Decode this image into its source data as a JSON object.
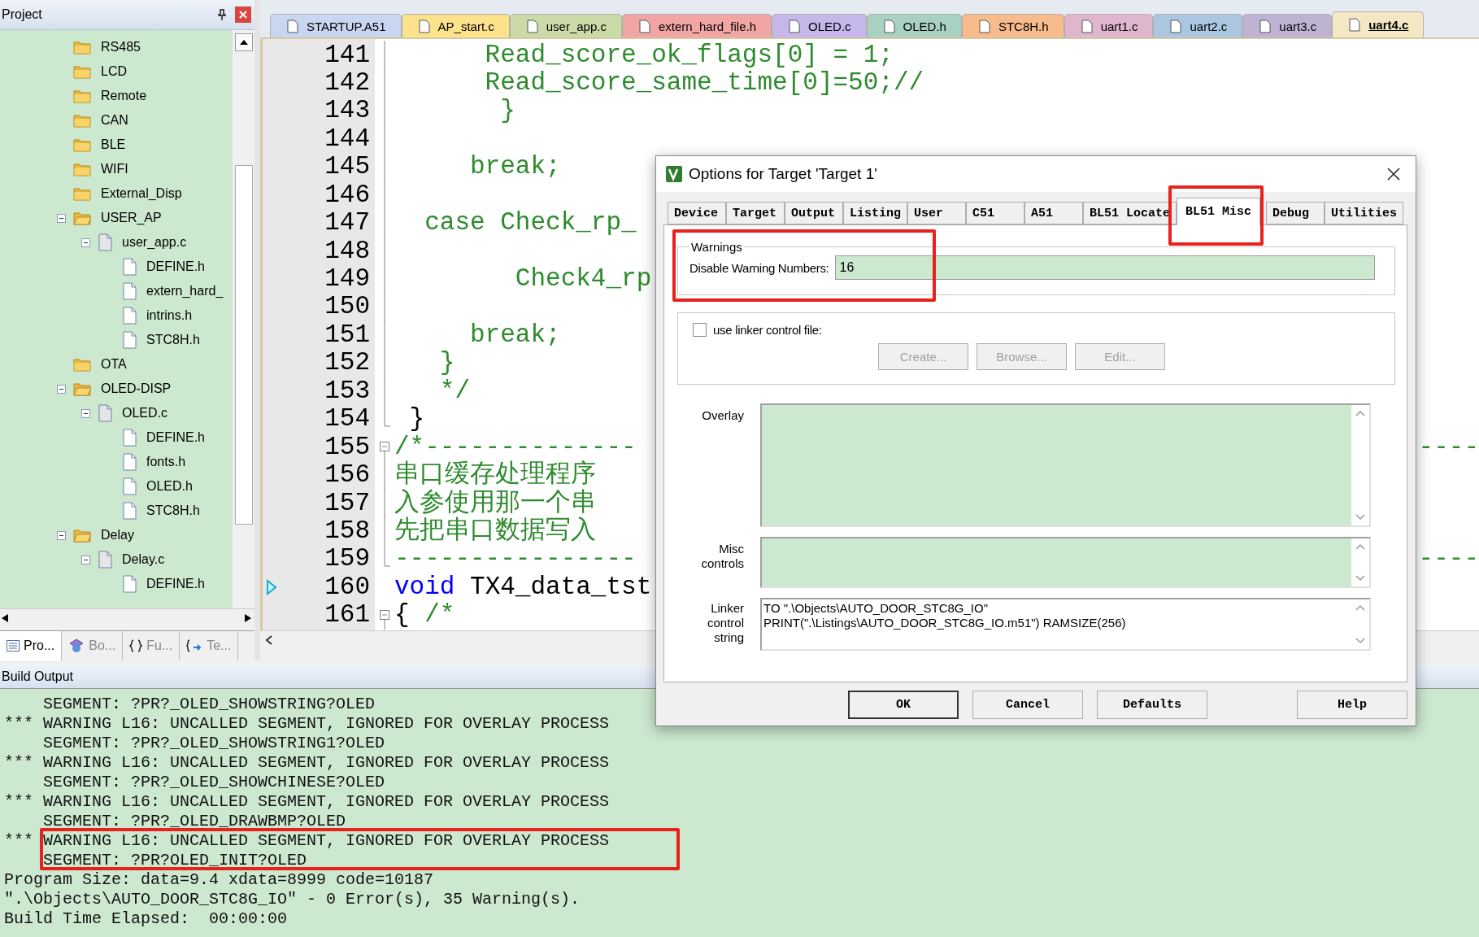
{
  "project_panel": {
    "title": "Project",
    "tree": [
      {
        "label": "RS485",
        "kind": "folder"
      },
      {
        "label": "LCD",
        "kind": "folder"
      },
      {
        "label": "Remote",
        "kind": "folder"
      },
      {
        "label": "CAN",
        "kind": "folder"
      },
      {
        "label": "BLE",
        "kind": "folder"
      },
      {
        "label": "WIFI",
        "kind": "folder"
      },
      {
        "label": "External_Disp",
        "kind": "folder"
      },
      {
        "label": "USER_AP",
        "kind": "folder",
        "expanded": true,
        "children": [
          {
            "label": "user_app.c",
            "kind": "source",
            "expanded": true,
            "children": [
              {
                "label": "DEFINE.h",
                "kind": "file"
              },
              {
                "label": "extern_hard_",
                "kind": "file"
              },
              {
                "label": "intrins.h",
                "kind": "file"
              },
              {
                "label": "STC8H.h",
                "kind": "file"
              }
            ]
          }
        ]
      },
      {
        "label": "OTA",
        "kind": "folder"
      },
      {
        "label": "OLED-DISP",
        "kind": "folder",
        "expanded": true,
        "children": [
          {
            "label": "OLED.c",
            "kind": "source",
            "expanded": true,
            "children": [
              {
                "label": "DEFINE.h",
                "kind": "file"
              },
              {
                "label": "fonts.h",
                "kind": "file"
              },
              {
                "label": "OLED.h",
                "kind": "file"
              },
              {
                "label": "STC8H.h",
                "kind": "file"
              }
            ]
          }
        ]
      },
      {
        "label": "Delay",
        "kind": "folder",
        "expanded": true,
        "children": [
          {
            "label": "Delay.c",
            "kind": "source",
            "expanded": true,
            "children": [
              {
                "label": "DEFINE.h",
                "kind": "file"
              }
            ]
          }
        ]
      }
    ],
    "tabs": [
      {
        "label": "Pro...",
        "kind": "project",
        "selected": true
      },
      {
        "label": "Bo...",
        "kind": "books",
        "selected": false
      },
      {
        "label": "Fu...",
        "kind": "functions",
        "selected": false
      },
      {
        "label": "Te...",
        "kind": "templates",
        "selected": false
      }
    ]
  },
  "editor": {
    "tabs": [
      {
        "label": "STARTUP.A51",
        "color": "#c8d6f2",
        "selected": false
      },
      {
        "label": "AP_start.c",
        "color": "#fde28c",
        "selected": false
      },
      {
        "label": "user_app.c",
        "color": "#cbdba8",
        "selected": false
      },
      {
        "label": "extern_hard_file.h",
        "color": "#f2a5a5",
        "selected": false
      },
      {
        "label": "OLED.c",
        "color": "#c6b7ea",
        "selected": false
      },
      {
        "label": "OLED.h",
        "color": "#a9d1c2",
        "selected": false
      },
      {
        "label": "STC8H.h",
        "color": "#f7bb8c",
        "selected": false
      },
      {
        "label": "uart1.c",
        "color": "#e0b6ce",
        "selected": false
      },
      {
        "label": "uart2.c",
        "color": "#abc6e0",
        "selected": false
      },
      {
        "label": "uart3.c",
        "color": "#bfb3d4",
        "selected": false
      },
      {
        "label": "uart4.c",
        "color": "#f4e8c4",
        "selected": true
      }
    ],
    "lines": [
      {
        "number": "141",
        "kind": "fold_body",
        "current": false,
        "segments": [
          {
            "text": "      Read_score_ok_flags[0] = 1;",
            "kind": "comment"
          }
        ]
      },
      {
        "number": "142",
        "kind": "fold_body",
        "current": false,
        "segments": [
          {
            "text": "      Read_score_same_time[0]=50;//",
            "kind": "comment"
          }
        ]
      },
      {
        "number": "143",
        "kind": "fold_body",
        "current": false,
        "segments": [
          {
            "text": "       }",
            "kind": "comment"
          }
        ]
      },
      {
        "number": "144",
        "kind": "fold_body",
        "current": false
      },
      {
        "number": "145",
        "kind": "fold_body",
        "current": false,
        "segments": [
          {
            "text": "     break;",
            "kind": "comment"
          }
        ]
      },
      {
        "number": "146",
        "kind": "fold_body",
        "current": false
      },
      {
        "number": "147",
        "kind": "fold_body",
        "current": false,
        "segments": [
          {
            "text": "  case Check_rp_",
            "kind": "comment"
          }
        ]
      },
      {
        "number": "148",
        "kind": "fold_body",
        "current": false
      },
      {
        "number": "149",
        "kind": "fold_body",
        "current": false,
        "segments": [
          {
            "text": "        Check4_rp",
            "kind": "comment"
          }
        ]
      },
      {
        "number": "150",
        "kind": "fold_body",
        "current": false
      },
      {
        "number": "151",
        "kind": "fold_body",
        "current": false,
        "segments": [
          {
            "text": "     break;",
            "kind": "comment"
          }
        ]
      },
      {
        "number": "152",
        "kind": "fold_body",
        "current": false,
        "segments": [
          {
            "text": "   }",
            "kind": "comment"
          }
        ]
      },
      {
        "number": "153",
        "kind": "fold_body",
        "current": false,
        "segments": [
          {
            "text": "   */",
            "kind": "comment"
          }
        ]
      },
      {
        "number": "154",
        "kind": "fold_end",
        "current": false,
        "segments": [
          {
            "text": " }",
            "kind": "plain"
          }
        ]
      },
      {
        "number": "155",
        "kind": "fold_start",
        "current": false,
        "segments": [
          {
            "text": "/*--------------",
            "kind": "comment"
          }
        ],
        "tail": "----"
      },
      {
        "number": "156",
        "kind": "fold_body",
        "current": false,
        "segments": [
          {
            "text": "串口缓存处理程序",
            "kind": "comment"
          }
        ]
      },
      {
        "number": "157",
        "kind": "fold_body",
        "current": false,
        "segments": [
          {
            "text": "入参使用那一个串",
            "kind": "comment"
          }
        ]
      },
      {
        "number": "158",
        "kind": "fold_body",
        "current": false,
        "segments": [
          {
            "text": "先把串口数据写入",
            "kind": "comment"
          }
        ]
      },
      {
        "number": "159",
        "kind": "fold_end",
        "current": false,
        "segments": [
          {
            "text": "----------------",
            "kind": "comment"
          }
        ],
        "tail": "----"
      },
      {
        "number": "160",
        "kind": "plain",
        "current": true,
        "segments": [
          {
            "text": "void",
            "kind": "keyword"
          },
          {
            "text": " TX4_data_tst",
            "kind": "plain"
          }
        ]
      },
      {
        "number": "161",
        "kind": "fold_start",
        "current": false,
        "segments": [
          {
            "text": "{",
            "kind": "plain"
          },
          {
            "text": " /*",
            "kind": "comment"
          }
        ]
      }
    ]
  },
  "dialog": {
    "title": "Options for Target 'Target 1'",
    "tabs": [
      {
        "label": "Device",
        "selected": false
      },
      {
        "label": "Target",
        "selected": false
      },
      {
        "label": "Output",
        "selected": false
      },
      {
        "label": "Listing",
        "selected": false
      },
      {
        "label": "User",
        "selected": false
      },
      {
        "label": "C51",
        "selected": false
      },
      {
        "label": "A51",
        "selected": false
      },
      {
        "label": "BL51 Locate",
        "selected": false
      },
      {
        "label": "BL51 Misc",
        "selected": true
      },
      {
        "label": "Debug",
        "selected": false
      },
      {
        "label": "Utilities",
        "selected": false
      }
    ],
    "warnings": {
      "title": "Warnings",
      "label": "Disable Warning Numbers:",
      "value": "16"
    },
    "linker_file": {
      "label": "use linker control file:",
      "checked": false,
      "buttons": [
        {
          "label": "Create...",
          "disabled": true
        },
        {
          "label": "Browse...",
          "disabled": true
        },
        {
          "label": "Edit...",
          "disabled": true
        }
      ]
    },
    "overlay": {
      "label": "Overlay"
    },
    "misc": {
      "label": "Misc controls"
    },
    "linker_string": {
      "label": "Linker control string",
      "lines": [
        "TO \".\\Objects\\AUTO_DOOR_STC8G_IO\"",
        "PRINT(\".\\Listings\\AUTO_DOOR_STC8G_IO.m51\") RAMSIZE(256)"
      ]
    },
    "buttons": [
      {
        "label": "OK",
        "default": true
      },
      {
        "label": "Cancel",
        "default": false
      },
      {
        "label": "Defaults",
        "default": false
      },
      {
        "label": "Help",
        "default": false
      }
    ]
  },
  "build_output": {
    "title": "Build Output",
    "lines": [
      "    SEGMENT: ?PR?_OLED_SHOWSTRING?OLED",
      "*** WARNING L16: UNCALLED SEGMENT, IGNORED FOR OVERLAY PROCESS",
      "    SEGMENT: ?PR?_OLED_SHOWSTRING1?OLED",
      "*** WARNING L16: UNCALLED SEGMENT, IGNORED FOR OVERLAY PROCESS",
      "    SEGMENT: ?PR?_OLED_SHOWCHINESE?OLED",
      "*** WARNING L16: UNCALLED SEGMENT, IGNORED FOR OVERLAY PROCESS",
      "    SEGMENT: ?PR?_OLED_DRAWBMP?OLED",
      "*** WARNING L16: UNCALLED SEGMENT, IGNORED FOR OVERLAY PROCESS",
      "    SEGMENT: ?PR?OLED_INIT?OLED",
      "Program Size: data=9.4 xdata=8999 code=10187",
      "\".\\Objects\\AUTO_DOOR_STC8G_IO\" - 0 Error(s), 35 Warning(s).",
      "Build Time Elapsed:  00:00:00"
    ]
  }
}
